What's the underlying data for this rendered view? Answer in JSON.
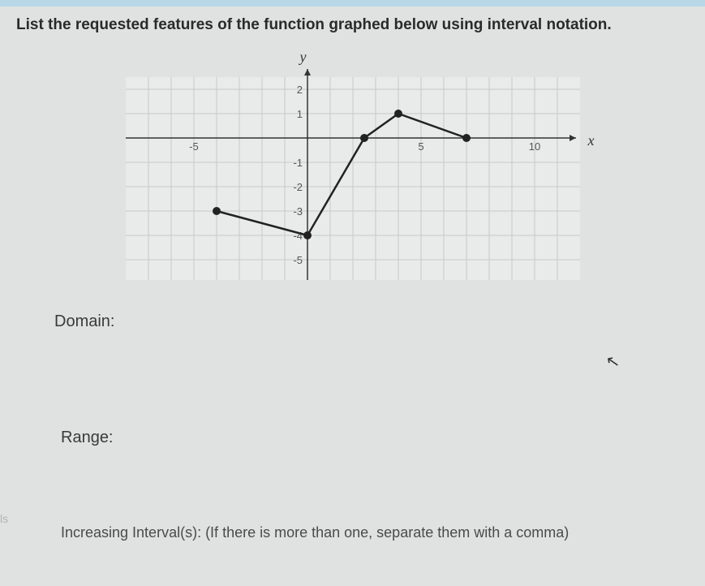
{
  "question": "List the requested features of the function graphed below using interval notation.",
  "axis": {
    "y_label": "y",
    "x_label": "x"
  },
  "prompts": {
    "domain": "Domain:",
    "range": "Range:",
    "increasing": "Increasing Interval(s): (If there is more than one, separate them with a comma)"
  },
  "sidebar_partial": "ls",
  "chart_data": {
    "type": "line",
    "x_ticks": [
      -5,
      5,
      10
    ],
    "y_ticks": [
      2,
      1,
      -1,
      -2,
      -3,
      -4,
      -5
    ],
    "xlim": [
      -8,
      12
    ],
    "ylim": [
      -5.5,
      2.5
    ],
    "series": [
      {
        "name": "function",
        "points": [
          {
            "x": -4,
            "y": -3
          },
          {
            "x": 0,
            "y": -4
          },
          {
            "x": 2.5,
            "y": 0
          },
          {
            "x": 4,
            "y": 1
          },
          {
            "x": 7,
            "y": 0
          }
        ]
      }
    ],
    "grid": true
  }
}
